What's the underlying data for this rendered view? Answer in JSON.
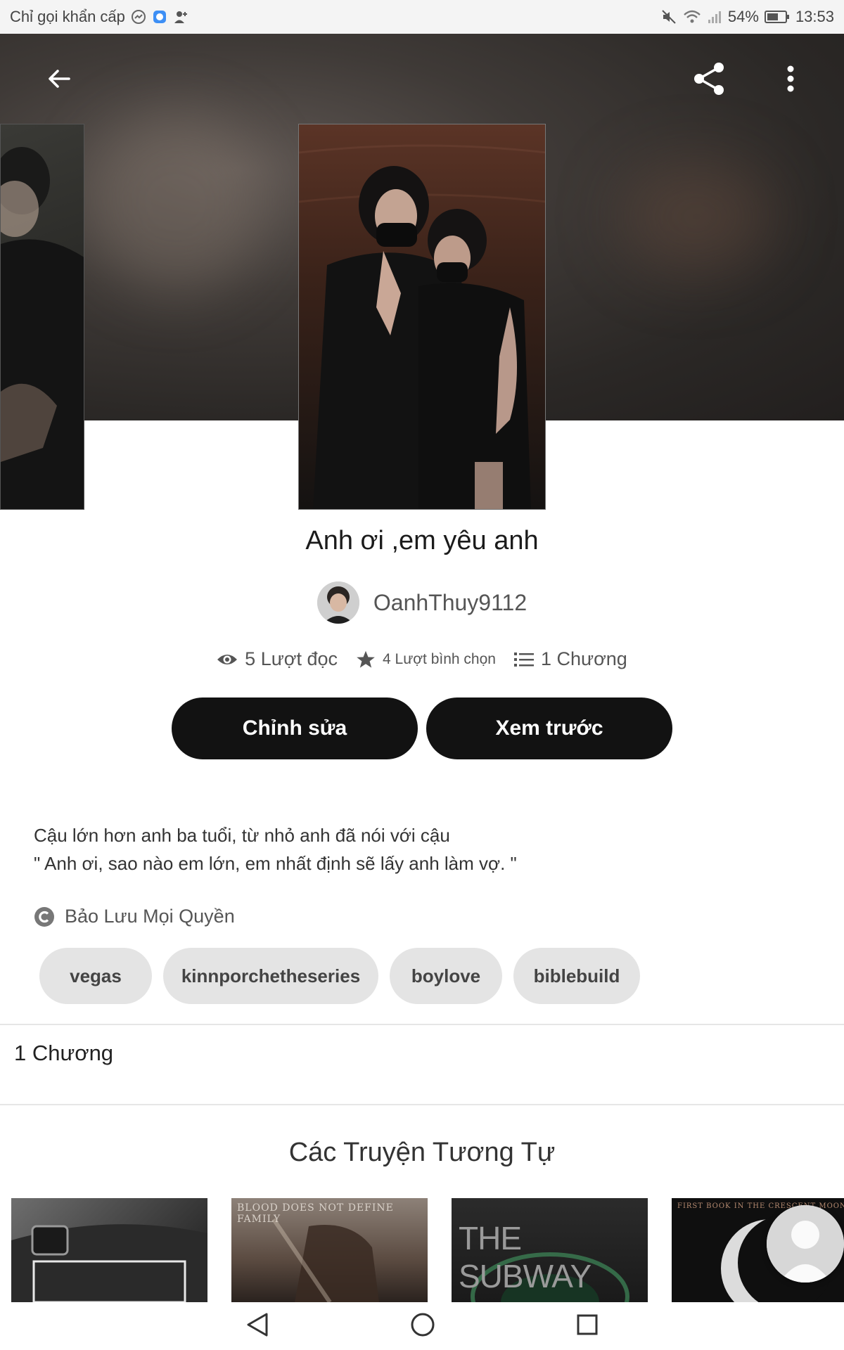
{
  "status_bar": {
    "carrier": "Chỉ gọi khẩn cấp",
    "battery": "54%",
    "time": "13:53"
  },
  "header": {
    "back_icon": "arrow-left-icon",
    "share_icon": "share-icon",
    "more_icon": "more-vertical-icon"
  },
  "story": {
    "title": "Anh ơi ,em yêu anh",
    "author": "OanhThuy9112",
    "stats": {
      "reads": "5 Lượt đọc",
      "votes": "4 Lượt bình chọn",
      "parts": "1 Chương"
    },
    "actions": {
      "edit": "Chỉnh sửa",
      "preview": "Xem trước"
    },
    "description": [
      "Cậu lớn hơn anh ba tuổi, từ nhỏ anh đã nói với cậu",
      "\" Anh ơi, sao nào em lớn, em nhất định sẽ lấy anh làm vợ. \""
    ],
    "copyright": "Bảo Lưu Mọi Quyền",
    "tags": [
      "vegas",
      "kinnporchetheseries",
      "boylove",
      "biblebuild"
    ]
  },
  "chapters": {
    "label": "1 Chương"
  },
  "similar": {
    "title": "Các Truyện Tương Tự",
    "covers": [
      {
        "text": ""
      },
      {
        "text": "BLOOD DOES NOT DEFINE FAMILY"
      },
      {
        "text": "THE SUBWAY"
      },
      {
        "text": "FIRST BOOK IN THE CRESCENT MOON"
      }
    ]
  },
  "colors": {
    "accent_dark": "#121212",
    "tag_bg": "#e4e4e4",
    "hero_bg": "#2b2826"
  }
}
